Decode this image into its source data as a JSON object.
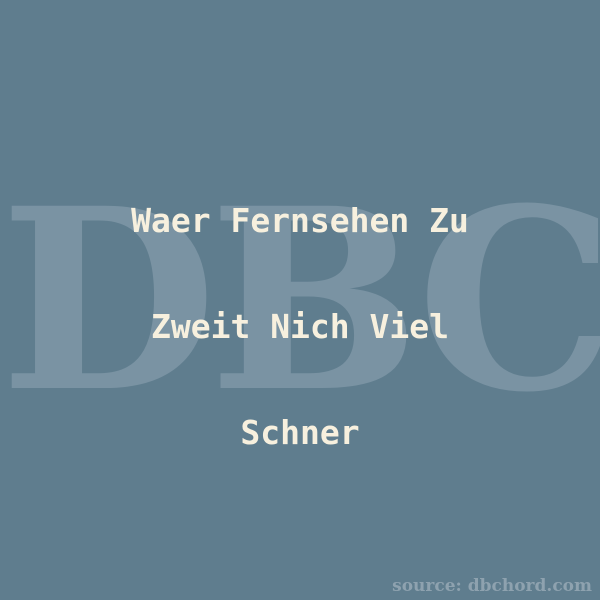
{
  "watermark": {
    "text": "DBC"
  },
  "title": {
    "lines": [
      "Waer Fernsehen Zu",
      "Zweit Nich Viel",
      "Schner"
    ]
  },
  "source": {
    "text": "source: dbchord.com"
  },
  "colors": {
    "background": "#5f7d8e",
    "title_text": "#f7f0de",
    "watermark": "#7a93a3",
    "source_text": "#8ea2af"
  }
}
